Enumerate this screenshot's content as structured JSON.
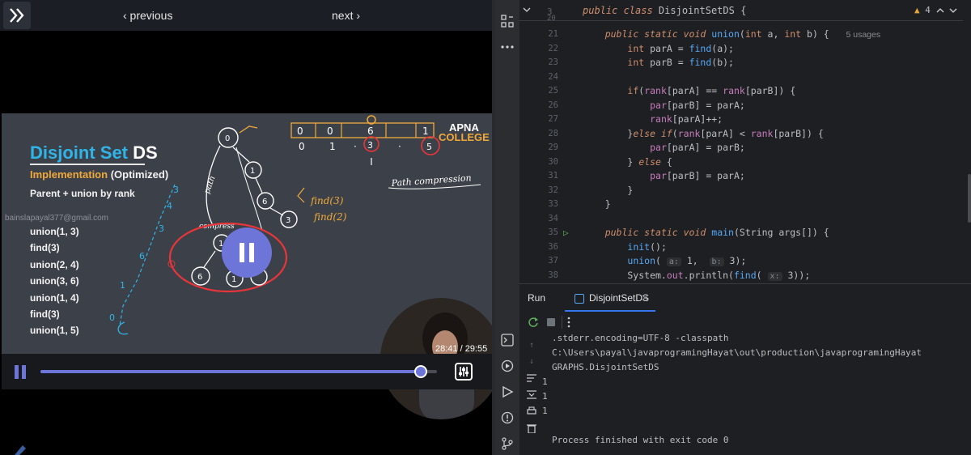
{
  "player": {
    "nav": {
      "previous": "‹ previous",
      "next": "next ›"
    },
    "slide": {
      "title_main": "Disjoint Set ",
      "title_ds": "DS",
      "subtitle_main": "Implementation ",
      "subtitle_opt": "(Optimized)",
      "parent_line": "Parent + union by rank",
      "watermark": "bainslapayal377@gmail.com",
      "operations": [
        "union(1, 3)",
        "find(3)",
        "union(2, 4)",
        "union(3, 6)",
        "union(1, 4)",
        "find(3)",
        "union(1, 5)"
      ],
      "brand_top": "APNA",
      "brand_bottom": "COLLEGE",
      "annotations": {
        "path_compression": "Path compression",
        "find_a": "find(3)",
        "find_b": "find(2)",
        "path": "path",
        "compress": "compress",
        "arr_indices": [
          "0",
          "1",
          "·",
          "3",
          "·",
          "5"
        ],
        "arr_vals": [
          "0",
          "0",
          "6",
          "1"
        ],
        "nodes": [
          "0",
          "1",
          "6",
          "3",
          "6",
          "1",
          "1",
          "3",
          "3",
          "6"
        ]
      }
    },
    "time_display": "28:41 / 29:55",
    "progress_fraction": 0.959,
    "accent": "#6e75d9"
  },
  "ide": {
    "sticky": {
      "line": "3",
      "code": "public class DisjointSetDS {",
      "first_line": "20"
    },
    "warnings": "4",
    "lines": [
      {
        "n": "21",
        "code": "    public static void union(int a, int b) {",
        "usages": "5 usages"
      },
      {
        "n": "22",
        "code": "        int parA = find(a);"
      },
      {
        "n": "23",
        "code": "        int parB = find(b);"
      },
      {
        "n": "24",
        "code": ""
      },
      {
        "n": "25",
        "code": "        if(rank[parA] == rank[parB]) {"
      },
      {
        "n": "26",
        "code": "            par[parB] = parA;"
      },
      {
        "n": "27",
        "code": "            rank[parA]++;"
      },
      {
        "n": "28",
        "code": "        }else if(rank[parA] < rank[parB]) {"
      },
      {
        "n": "29",
        "code": "            par[parA] = parB;"
      },
      {
        "n": "30",
        "code": "        } else {"
      },
      {
        "n": "31",
        "code": "            par[parB] = parA;"
      },
      {
        "n": "32",
        "code": "        }"
      },
      {
        "n": "33",
        "code": "    }"
      },
      {
        "n": "34",
        "code": ""
      },
      {
        "n": "35",
        "code": "    public static void main(String args[]) {"
      },
      {
        "n": "36",
        "code": "        init();"
      },
      {
        "n": "37",
        "code": "        union( a: 1,  b: 3);"
      },
      {
        "n": "38",
        "code": "        System.out.println(find( x: 3));"
      }
    ],
    "run_panel": {
      "label": "Run",
      "tab": "DisjointSetDS",
      "output": [
        ".stderr.encoding=UTF-8 -classpath",
        "C:\\Users\\payal\\javaprogramingHayat\\out\\production\\javaprogramingHayat",
        "GRAPHS.DisjointSetDS",
        "1",
        "1",
        "1",
        "",
        "Process finished with exit code 0"
      ]
    }
  }
}
